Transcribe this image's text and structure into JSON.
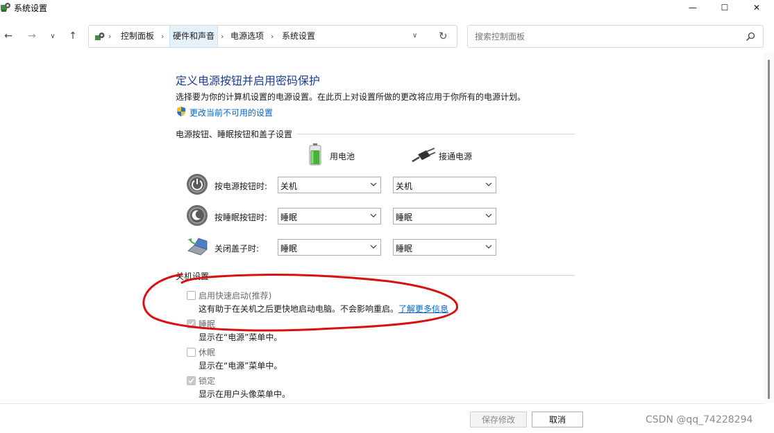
{
  "window": {
    "title": "系统设置",
    "minimize_glyph": "—",
    "maximize_glyph": "☐",
    "close_glyph": "✕"
  },
  "nav": {
    "back_glyph": "←",
    "forward_glyph": "→",
    "recent_glyph": "∨",
    "up_glyph": "↑"
  },
  "address": {
    "crumbs": [
      "控制面板",
      "硬件和声音",
      "电源选项",
      "系统设置"
    ],
    "separator": "›",
    "dropdown_glyph": "∨",
    "refresh_glyph": "↻"
  },
  "search": {
    "placeholder": "搜索控制面板",
    "icon": "search-icon"
  },
  "main": {
    "title": "定义电源按钮并启用密码保护",
    "description": "选择要为你的计算机设置的电源设置。在此页上对设置所做的更改将应用于你所有的电源计划。",
    "change_link": "更改当前不可用的设置"
  },
  "power_buttons": {
    "section_title": "电源按钮、睡眠按钮和盖子设置",
    "col_battery": "用电池",
    "col_plugged": "接通电源",
    "rows": [
      {
        "label": "按电源按钮时:",
        "battery": "关机",
        "plugged": "关机",
        "icon": "power-button-icon"
      },
      {
        "label": "按睡眠按钮时:",
        "battery": "睡眠",
        "plugged": "睡眠",
        "icon": "sleep-button-icon"
      },
      {
        "label": "关闭盖子时:",
        "battery": "睡眠",
        "plugged": "睡眠",
        "icon": "laptop-lid-icon"
      }
    ]
  },
  "shutdown": {
    "section_title": "关机设置",
    "options": [
      {
        "title": "启用快速启动(推荐)",
        "desc": "这有助于在关机之后更快地启动电脑。不会影响重启。",
        "link": "了解更多信息",
        "checked": false
      },
      {
        "title": "睡眠",
        "desc": "显示在“电源”菜单中。",
        "checked": true
      },
      {
        "title": "休眠",
        "desc": "显示在“电源”菜单中。",
        "checked": false
      },
      {
        "title": "锁定",
        "desc": "显示在用户头像菜单中。",
        "checked": true
      }
    ]
  },
  "footer": {
    "save_label": "保存修改",
    "cancel_label": "取消"
  },
  "watermark": "CSDN @qq_74228294",
  "colors": {
    "title_blue": "#1e3d8f",
    "link_blue": "#0066cc",
    "annotation_red": "#d81010"
  }
}
